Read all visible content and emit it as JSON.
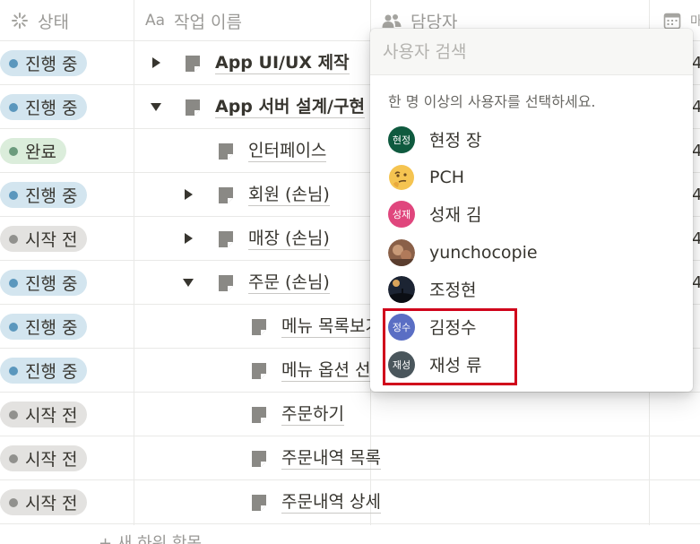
{
  "header": {
    "status_label": "상태",
    "name_label": "작업 이름",
    "name_icon": "Aa",
    "assignee_label": "담당자",
    "date_label": "마"
  },
  "rows": [
    {
      "status": "진행 중",
      "status_type": "in-progress",
      "toggle": "collapsed",
      "indent": 0,
      "name": "App UI/UX 제작",
      "bold": true,
      "trail": "4"
    },
    {
      "status": "진행 중",
      "status_type": "in-progress",
      "toggle": "expanded",
      "indent": 0,
      "name": "App 서버 설계/구현",
      "bold": true,
      "trail": "4"
    },
    {
      "status": "완료",
      "status_type": "done",
      "toggle": "none",
      "indent": 1,
      "name": "인터페이스",
      "bold": false,
      "trail": "4"
    },
    {
      "status": "진행 중",
      "status_type": "in-progress",
      "toggle": "collapsed",
      "indent": 1,
      "name": "회원 (손님)",
      "bold": false,
      "trail": "4"
    },
    {
      "status": "시작 전",
      "status_type": "not-started",
      "toggle": "collapsed",
      "indent": 1,
      "name": "매장 (손님)",
      "bold": false,
      "trail": "4"
    },
    {
      "status": "진행 중",
      "status_type": "in-progress",
      "toggle": "expanded",
      "indent": 1,
      "name": "주문 (손님)",
      "bold": false,
      "trail": "4"
    },
    {
      "status": "진행 중",
      "status_type": "in-progress",
      "toggle": "none",
      "indent": 2,
      "name": "메뉴 목록보기",
      "bold": false,
      "trail": ""
    },
    {
      "status": "진행 중",
      "status_type": "in-progress",
      "toggle": "none",
      "indent": 2,
      "name": "메뉴 옵션 선택",
      "bold": false,
      "trail": ""
    },
    {
      "status": "시작 전",
      "status_type": "not-started",
      "toggle": "none",
      "indent": 2,
      "name": "주문하기",
      "bold": false,
      "trail": ""
    },
    {
      "status": "시작 전",
      "status_type": "not-started",
      "toggle": "none",
      "indent": 2,
      "name": "주문내역 목록",
      "bold": false,
      "trail": ""
    },
    {
      "status": "시작 전",
      "status_type": "not-started",
      "toggle": "none",
      "indent": 2,
      "name": "주문내역 상세",
      "bold": false,
      "trail": ""
    }
  ],
  "new_row_label": "+ 새 하위 항목",
  "status_colors": {
    "in-progress": {
      "bg": "#d3e5ef",
      "dot": "#5b97bd"
    },
    "done": {
      "bg": "#dbeddb",
      "dot": "#6c9b7d"
    },
    "not-started": {
      "bg": "#e3e2e0",
      "dot": "#91918e"
    }
  },
  "popup": {
    "search_placeholder": "사용자 검색",
    "hint": "한 명 이상의 사용자를 선택하세요.",
    "users": [
      {
        "name": "현정 장",
        "avatar_text": "현정",
        "avatar_color": "#0f5a3f",
        "avatar_kind": "text"
      },
      {
        "name": "PCH",
        "avatar_text": "",
        "avatar_color": "#f5c451",
        "avatar_kind": "emoji-thinking"
      },
      {
        "name": "성재 김",
        "avatar_text": "성재",
        "avatar_color": "#e0467d",
        "avatar_kind": "text"
      },
      {
        "name": "yunchocopie",
        "avatar_text": "",
        "avatar_color": "#a0735a",
        "avatar_kind": "photo-warm"
      },
      {
        "name": "조정현",
        "avatar_text": "",
        "avatar_color": "#1c2433",
        "avatar_kind": "photo-night"
      },
      {
        "name": "김정수",
        "avatar_text": "정수",
        "avatar_color": "#5a6ec4",
        "avatar_kind": "text"
      },
      {
        "name": "재성 류",
        "avatar_text": "재성",
        "avatar_color": "#4a565c",
        "avatar_kind": "text"
      }
    ]
  }
}
